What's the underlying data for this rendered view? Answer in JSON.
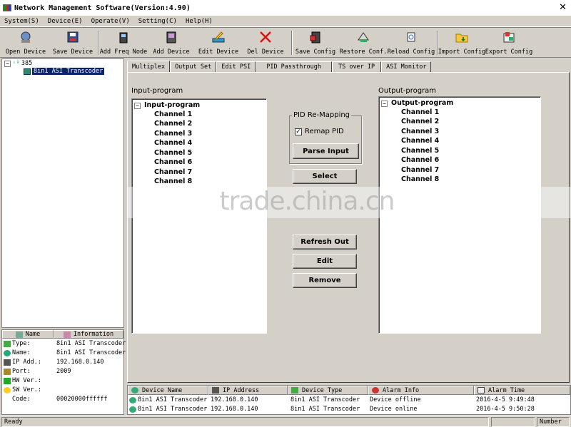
{
  "window": {
    "title": "Network Management Software(Version:4.90)",
    "close_glyph": "✕"
  },
  "menu": [
    "System(S)",
    "Device(E)",
    "Operate(V)",
    "Setting(C)",
    "Help(H)"
  ],
  "toolbar": [
    {
      "label": "Open Device",
      "icon": "open-device-icon"
    },
    {
      "label": "Save Device",
      "icon": "save-device-icon"
    },
    {
      "label": "Add Freq Node",
      "icon": "add-freq-node-icon"
    },
    {
      "label": "Add Device",
      "icon": "add-device-icon"
    },
    {
      "label": "Edit Device",
      "icon": "edit-device-icon"
    },
    {
      "label": "Del Device",
      "icon": "delete-device-icon"
    },
    {
      "label": "Save Config",
      "icon": "save-config-icon"
    },
    {
      "label": "Restore Conf.",
      "icon": "restore-config-icon"
    },
    {
      "label": "Reload Config",
      "icon": "reload-config-icon"
    },
    {
      "label": "Import Config",
      "icon": "import-config-icon"
    },
    {
      "label": "Export Config",
      "icon": "export-config-icon"
    }
  ],
  "tree": {
    "root": "385",
    "child": "8in1 ASI Transcoder"
  },
  "info": {
    "headers": [
      "Name",
      "Information"
    ],
    "rows": [
      {
        "name": "Type:",
        "value": "8in1 ASI Transcoder"
      },
      {
        "name": "Name:",
        "value": "8in1 ASI Transcoder"
      },
      {
        "name": "IP Add.:",
        "value": "192.168.0.140"
      },
      {
        "name": "Port:",
        "value": "2009"
      },
      {
        "name": "HW Ver.:",
        "value": ""
      },
      {
        "name": "SW Ver.:",
        "value": ""
      },
      {
        "name": "Code:",
        "value": "00020000ffffff"
      }
    ]
  },
  "tabs": [
    "Multiplex",
    "Output Set",
    "Edit PSI",
    "PID Passthrough",
    "TS over IP",
    "ASI Monitor"
  ],
  "multiplex": {
    "input_label": "Input-program",
    "input_root": "Input-program",
    "input_channels": [
      "Channel 1",
      "Channel 2",
      "Channel 3",
      "Channel 4",
      "Channel 5",
      "Channel 6",
      "Channel 7",
      "Channel 8"
    ],
    "output_label": "Output-program",
    "output_root": "Output-program",
    "output_channels": [
      "Channel 1",
      "Channel 2",
      "Channel 3",
      "Channel 4",
      "Channel 5",
      "Channel 6",
      "Channel 7",
      "Channel 8"
    ],
    "pid_group": "PID Re-Mapping",
    "remap_pid": {
      "label": "Remap PID",
      "checked": true
    },
    "parse_input": "Parse Input",
    "select": "Select",
    "refresh_out": "Refresh Out",
    "edit": "Edit",
    "remove": "Remove"
  },
  "alarm": {
    "headers": [
      "Device Name",
      "IP Address",
      "Device Type",
      "Alarm Info",
      "Alarm Time"
    ],
    "rows": [
      [
        "8in1 ASI Transcoder",
        "192.168.0.140",
        "8in1 ASI Transcoder",
        "Device offline",
        "2016-4-5 9:49:48"
      ],
      [
        "8in1 ASI Transcoder",
        "192.168.0.140",
        "8in1 ASI Transcoder",
        "Device online",
        "2016-4-5 9:50:28"
      ]
    ]
  },
  "status": {
    "left": "Ready",
    "right": "Number"
  },
  "watermark": "trade.china.cn"
}
